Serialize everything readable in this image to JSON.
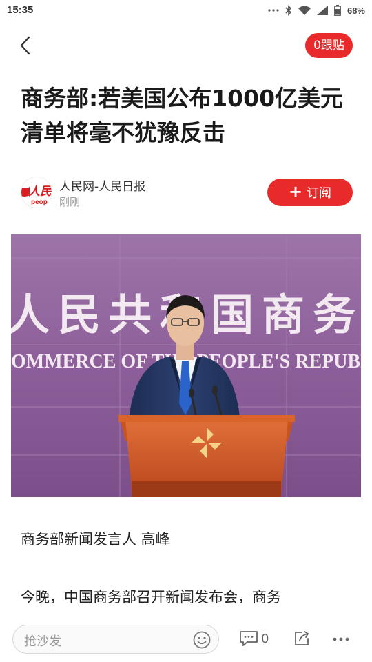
{
  "status_bar": {
    "time": "15:35",
    "battery": "68%",
    "icons": [
      "more-dots-icon",
      "bluetooth-icon",
      "wifi-icon",
      "signal-icon",
      "battery-icon"
    ]
  },
  "nav": {
    "back_icon": "back-chevron-icon",
    "comments_pill": "0跟贴"
  },
  "article": {
    "title_line1": "商务部:若美国公布1000亿美元",
    "title_line2": "清单将毫不犹豫反击",
    "source_name": "人民网-人民日报",
    "source_time": "刚刚",
    "subscribe_label": "订阅",
    "logo_text": "人民",
    "logo_subtext": "peop",
    "photo_sign_cn": "人民共和国商务",
    "photo_sign_en": "OMMERCE OF THE PEOPLE'S REPUBLIC O",
    "caption": "商务部新闻发言人 高峰",
    "paragraph_start": "今晚，中国商务部召开新闻发布会，商务"
  },
  "bottom_bar": {
    "comment_placeholder": "抢沙发",
    "comment_count": "0"
  },
  "colors": {
    "accent_red": "#e82a2a",
    "backdrop_purple": "#8a5a98"
  }
}
